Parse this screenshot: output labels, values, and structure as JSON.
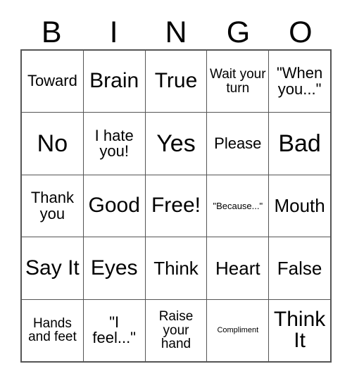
{
  "card": {
    "title": "BINGO",
    "header_letters": [
      "B",
      "I",
      "N",
      "G",
      "O"
    ],
    "colors": {
      "background": "#ffffff",
      "text": "#000000",
      "grid_line": "#555555"
    },
    "rows": 5,
    "columns": 5,
    "free_space_label": "Free!",
    "cells": [
      [
        {
          "text": "Toward",
          "size": "md"
        },
        {
          "text": "Brain",
          "size": "xl"
        },
        {
          "text": "True",
          "size": "xl"
        },
        {
          "text": "Wait your turn",
          "size": "sm"
        },
        {
          "text": "\"When you...\"",
          "size": "md"
        }
      ],
      [
        {
          "text": "No",
          "size": "xxl"
        },
        {
          "text": "I hate you!",
          "size": "md"
        },
        {
          "text": "Yes",
          "size": "xxl"
        },
        {
          "text": "Please",
          "size": "md"
        },
        {
          "text": "Bad",
          "size": "xxl"
        }
      ],
      [
        {
          "text": "Thank you",
          "size": "md"
        },
        {
          "text": "Good",
          "size": "xl"
        },
        {
          "text": "Free!",
          "size": "xl"
        },
        {
          "text": "\"Because...\"",
          "size": "xs"
        },
        {
          "text": "Mouth",
          "size": "lg"
        }
      ],
      [
        {
          "text": "Say It",
          "size": "xl"
        },
        {
          "text": "Eyes",
          "size": "xl"
        },
        {
          "text": "Think",
          "size": "lg"
        },
        {
          "text": "Heart",
          "size": "lg"
        },
        {
          "text": "False",
          "size": "lg"
        }
      ],
      [
        {
          "text": "Hands and feet",
          "size": "sm"
        },
        {
          "text": "\"I feel...\"",
          "size": "md"
        },
        {
          "text": "Raise your hand",
          "size": "sm"
        },
        {
          "text": "Compliment",
          "size": "xxs"
        },
        {
          "text": "Think It",
          "size": "xl"
        }
      ]
    ]
  }
}
